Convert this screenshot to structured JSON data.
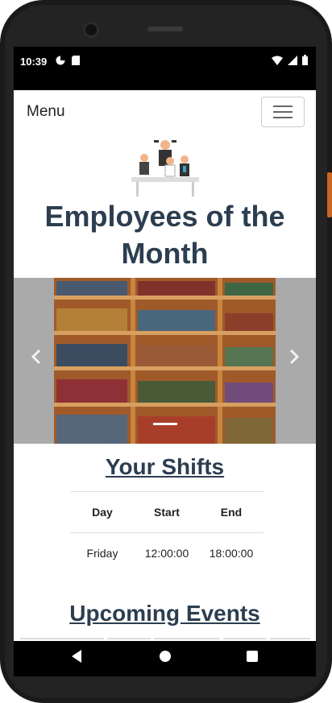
{
  "status_bar": {
    "time": "10:39"
  },
  "navbar": {
    "menu_label": "Menu"
  },
  "header": {
    "title_line1": "Employees of the",
    "title_line2": "Month"
  },
  "carousel": {
    "prev_icon": "chevron-left-icon",
    "next_icon": "chevron-right-icon"
  },
  "shifts": {
    "title": "Your Shifts",
    "headers": [
      "Day",
      "Start",
      "End"
    ],
    "rows": [
      [
        "Friday",
        "12:00:00",
        "18:00:00"
      ]
    ]
  },
  "events": {
    "title": "Upcoming Events"
  },
  "colors": {
    "title": "#2c3e50",
    "phone_accent": "#c9661f"
  }
}
